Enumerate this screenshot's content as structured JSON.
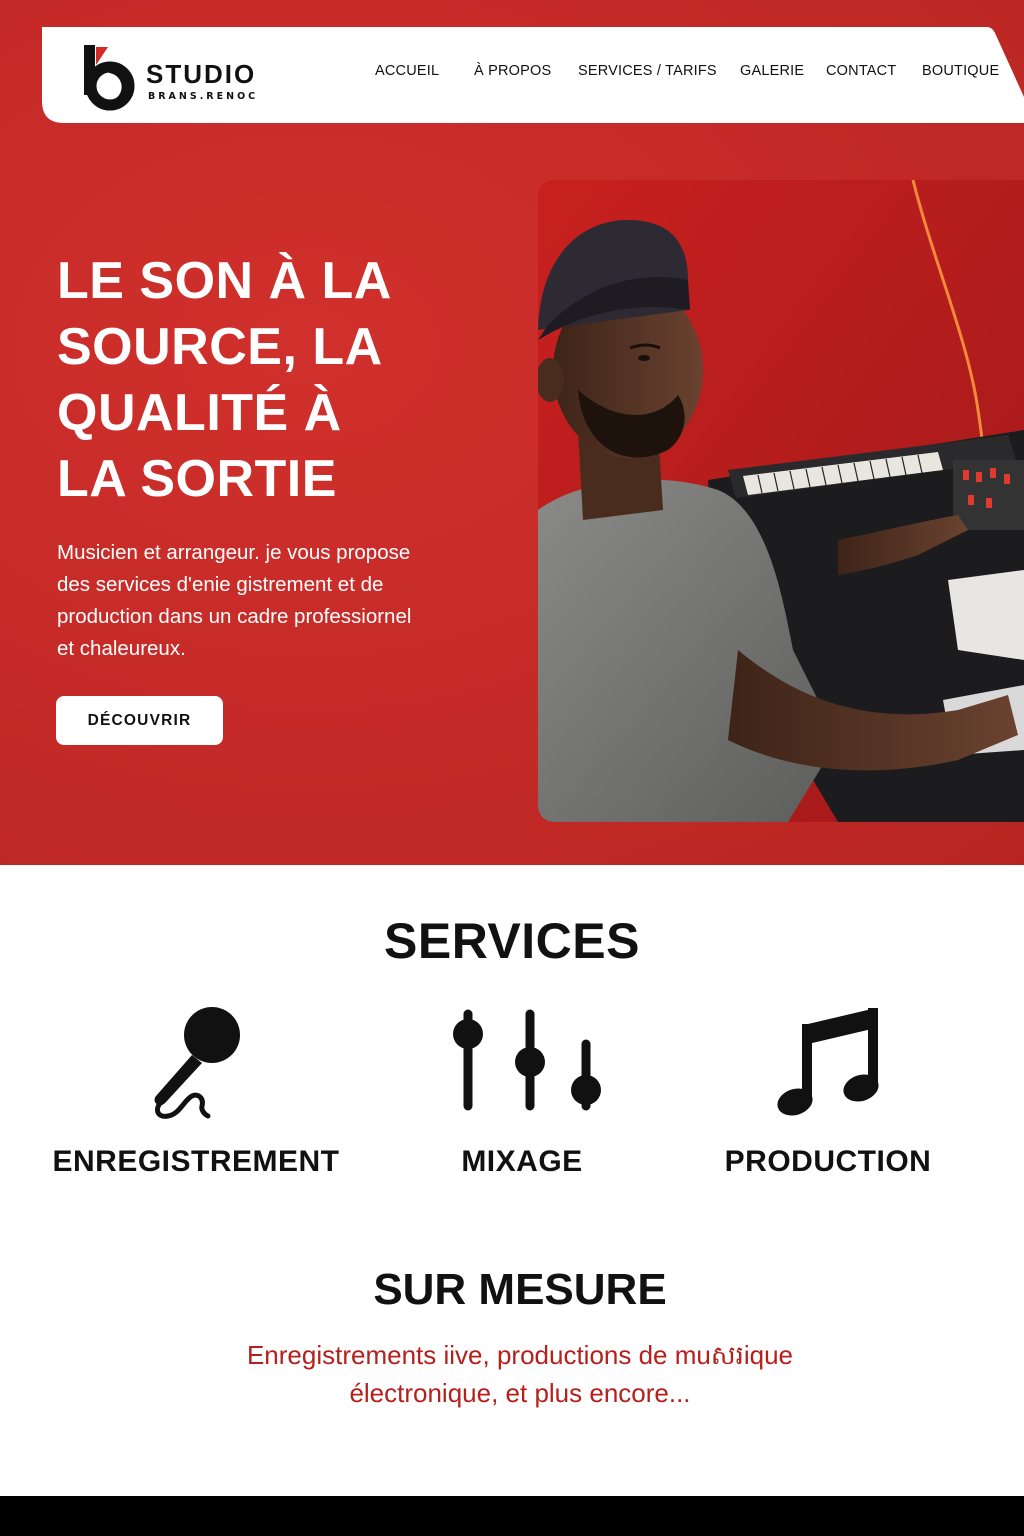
{
  "brand": {
    "name": "STUDIO",
    "tagline": "BRANS.RENOC"
  },
  "nav": {
    "items": [
      "ACCUEIL",
      "À PROPOS",
      "SERVICES / TARIFS",
      "GALERIE",
      "CONTACT",
      "BOUTIQUE"
    ]
  },
  "hero": {
    "title_lines": [
      "LE SON À LA",
      "SOURCE, LA",
      "QUALITÉ À",
      "LA SORTIE"
    ],
    "description_lines": [
      "Musicien et arrangeur. je vous propose",
      "des services d'enie gistrement et de",
      "production dans un cadre professiornel",
      "et chaleureux."
    ],
    "cta_label": "DÉCOUVRIR",
    "photo_icon": "studio-photo"
  },
  "services": {
    "title": "SERVICES",
    "items": [
      {
        "label": "ENREGISTREMENT",
        "icon": "microphone-icon"
      },
      {
        "label": "MIXAGE",
        "icon": "mixer-sliders-icon"
      },
      {
        "label": "PRODUCTION",
        "icon": "music-note-icon"
      }
    ]
  },
  "sur_mesure": {
    "title": "SUR MESURE",
    "description_lines": [
      "Enregistrements iive, productions de muសរique",
      "électronique, et plus encore..."
    ]
  },
  "colors": {
    "brand_red": "#c62a27",
    "accent_text_red": "#b5201c",
    "footer": "#000000"
  }
}
